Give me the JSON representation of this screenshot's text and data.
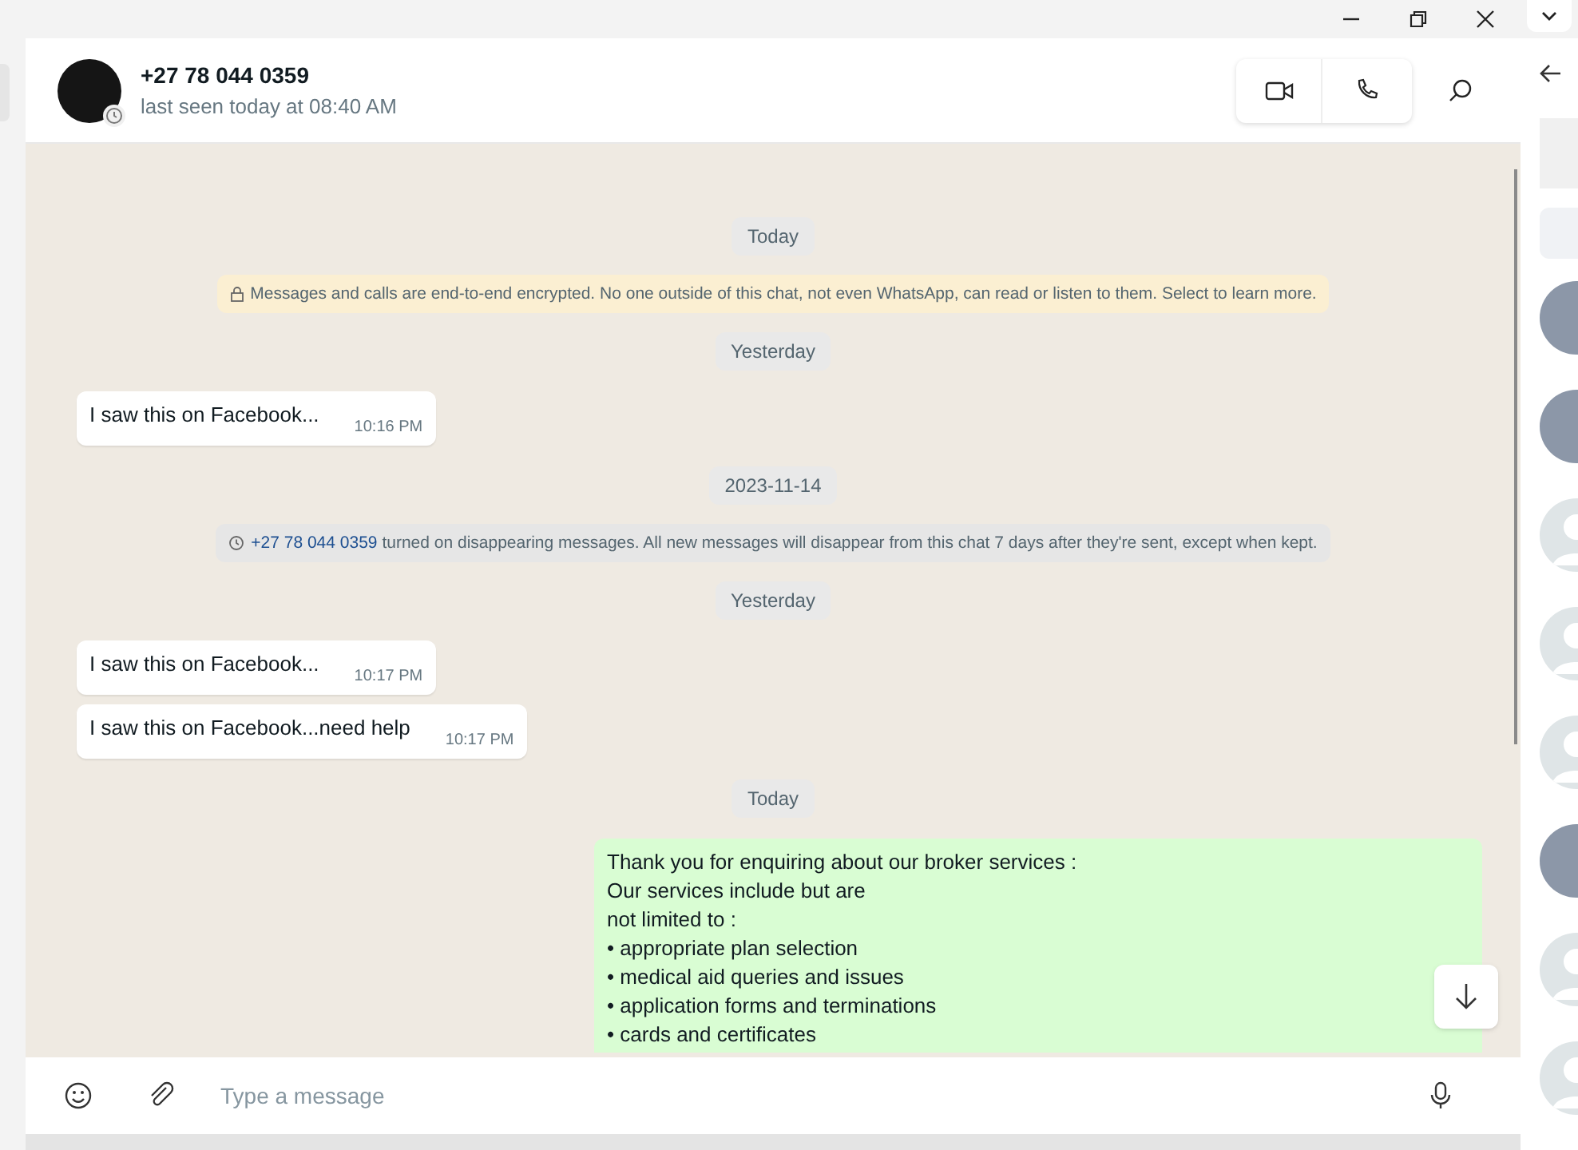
{
  "chat_header": {
    "name": "+27 78 044 0359",
    "status": "last seen today at 08:40 AM"
  },
  "messages": [
    {
      "kind": "date",
      "text": "Today"
    },
    {
      "kind": "encryption",
      "text": "Messages and calls are end-to-end encrypted. No one outside of this chat, not even WhatsApp, can read or listen to them. Select to learn more."
    },
    {
      "kind": "date",
      "text": "Yesterday"
    },
    {
      "kind": "incoming",
      "text": "I saw this on Facebook...",
      "time": "10:16 PM"
    },
    {
      "kind": "date",
      "text": "2023-11-14"
    },
    {
      "kind": "system",
      "link": "+27 78 044 0359",
      "text": "turned on disappearing messages. All new messages will disappear from this chat 7 days after they're sent, except when kept."
    },
    {
      "kind": "date",
      "text": "Yesterday"
    },
    {
      "kind": "incoming",
      "text": "I saw this on Facebook...",
      "time": "10:17 PM"
    },
    {
      "kind": "incoming",
      "text": "I saw this on Facebook...need help",
      "time": "10:17 PM"
    },
    {
      "kind": "date",
      "text": "Today"
    },
    {
      "kind": "outgoing",
      "lines": [
        "Thank you for enquiring about our broker services :",
        "Our services include but are",
        "not limited to :",
        "• appropriate plan selection",
        "• medical aid queries and issues",
        "• application forms and terminations",
        "• cards and certificates"
      ]
    }
  ],
  "composer": {
    "placeholder": "Type a message"
  },
  "side_panel": {
    "contacts": [
      {
        "kind": "photo"
      },
      {
        "kind": "photo"
      },
      {
        "kind": "default"
      },
      {
        "kind": "default"
      },
      {
        "kind": "default"
      },
      {
        "kind": "photo"
      },
      {
        "kind": "default"
      },
      {
        "kind": "default"
      }
    ]
  }
}
